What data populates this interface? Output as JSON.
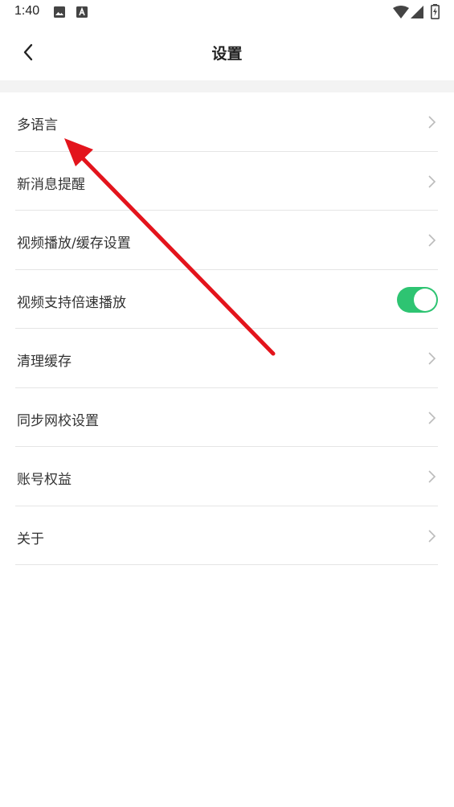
{
  "status_bar": {
    "time": "1:40",
    "left_icons": [
      "image-icon",
      "a-box-icon"
    ],
    "right_icons": [
      "wifi-icon",
      "signal-icon",
      "battery-charging-icon"
    ]
  },
  "header": {
    "back_icon": "chevron-left-icon",
    "title": "设置"
  },
  "settings": {
    "items": [
      {
        "label": "多语言",
        "control": "chevron"
      },
      {
        "label": "新消息提醒",
        "control": "chevron"
      },
      {
        "label": "视频播放/缓存设置",
        "control": "chevron"
      },
      {
        "label": "视频支持倍速播放",
        "control": "toggle",
        "toggle_on": true
      },
      {
        "label": "清理缓存",
        "control": "chevron"
      },
      {
        "label": "同步网校设置",
        "control": "chevron"
      },
      {
        "label": "账号权益",
        "control": "chevron"
      },
      {
        "label": "关于",
        "control": "chevron"
      }
    ]
  },
  "colors": {
    "toggle_on": "#2ec472",
    "annotation_arrow": "#e3141c",
    "divider": "#e5e5e5",
    "band": "#f3f3f3"
  }
}
